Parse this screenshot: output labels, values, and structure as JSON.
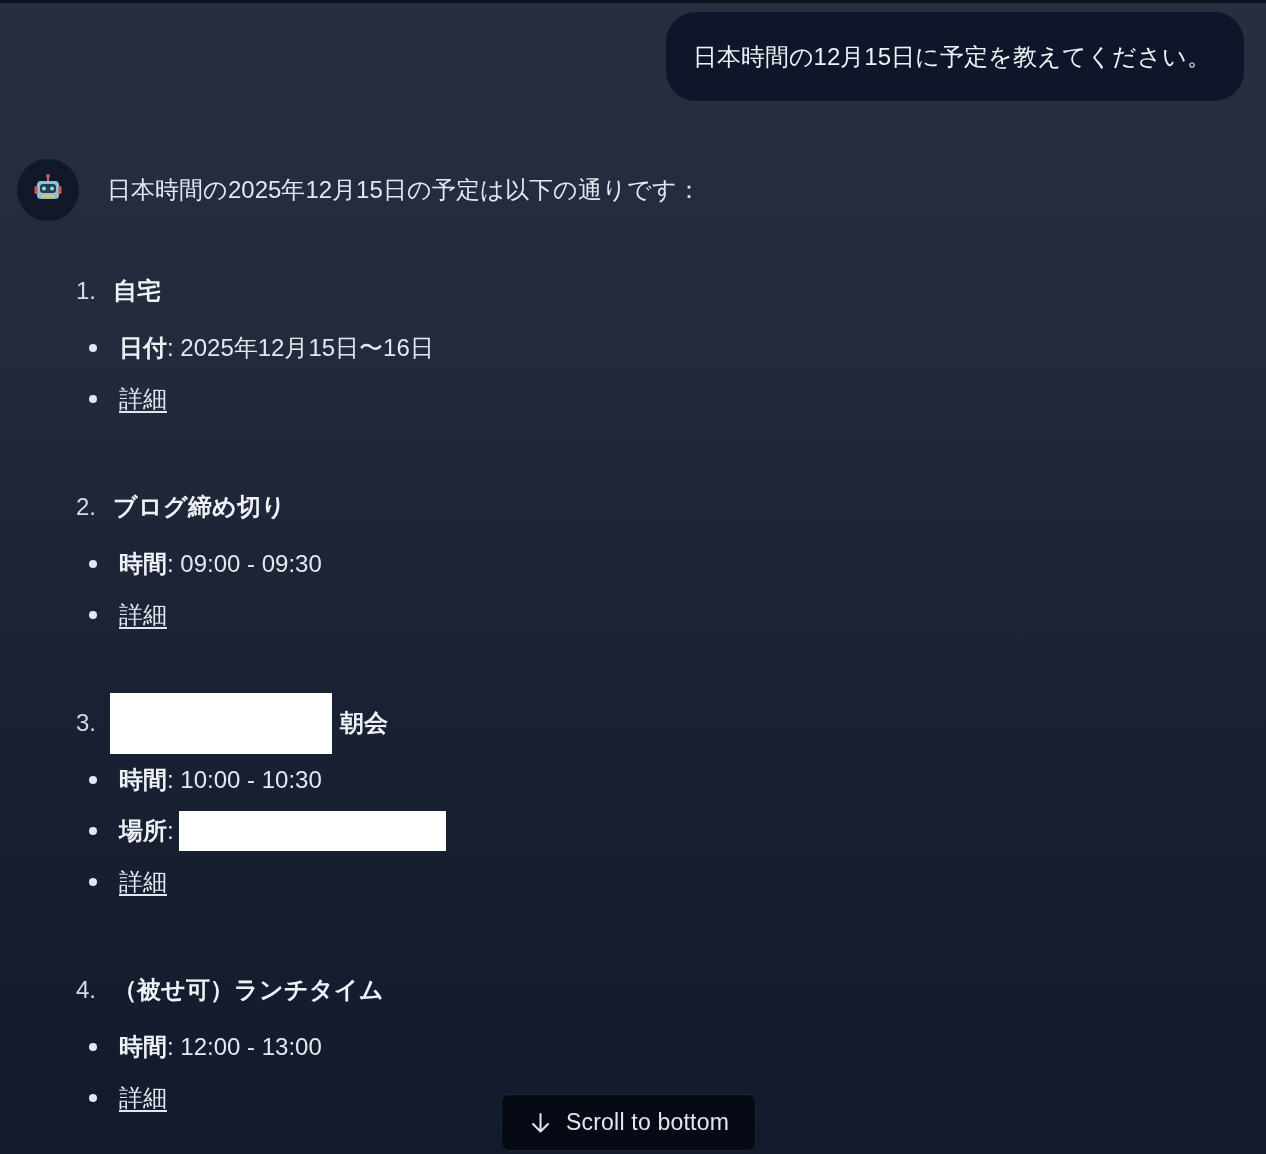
{
  "user_message": {
    "text": "日本時間の12月15日に予定を教えてください。"
  },
  "assistant_message": {
    "intro": "日本時間の2025年12月15日の予定は以下の通りです：",
    "items": [
      {
        "number": "1.",
        "redacted_head": false,
        "title": "自宅",
        "details": [
          {
            "kind": "line",
            "text": "**日付**: 2025年12月15日〜16日",
            "redacted_tail": false
          },
          {
            "kind": "link",
            "text": "詳細"
          }
        ]
      },
      {
        "number": "2.",
        "redacted_head": false,
        "title": "ブログ締め切り",
        "details": [
          {
            "kind": "line",
            "text": "**時間**: 09:00 - 09:30",
            "redacted_tail": false
          },
          {
            "kind": "link",
            "text": "詳細"
          }
        ]
      },
      {
        "number": "3.",
        "redacted_head": true,
        "title": "朝会",
        "details": [
          {
            "kind": "line",
            "text": "**時間**: 10:00 - 10:30",
            "redacted_tail": false
          },
          {
            "kind": "line",
            "text": "**場所**:",
            "redacted_tail": true
          },
          {
            "kind": "link",
            "text": "詳細"
          }
        ]
      },
      {
        "number": "4.",
        "redacted_head": false,
        "title": "（被せ可）ランチタイム",
        "details": [
          {
            "kind": "line",
            "text": "**時間**: 12:00 - 13:00",
            "redacted_tail": false
          },
          {
            "kind": "link",
            "text": "詳細"
          }
        ]
      }
    ]
  },
  "scroll_button": {
    "label": "Scroll to bottom"
  }
}
